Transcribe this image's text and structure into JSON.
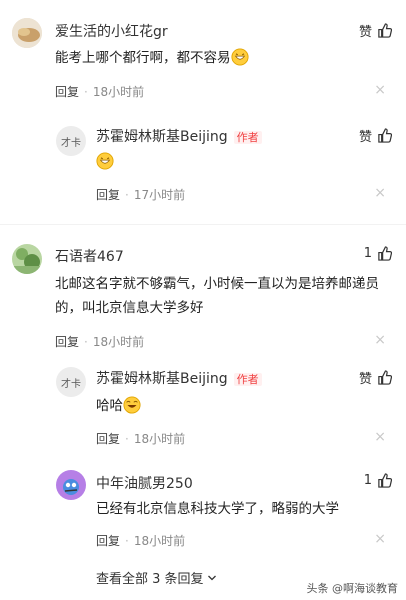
{
  "reply_label": "回复",
  "close_glyph": "×",
  "author_badge": "作者",
  "comments": [
    {
      "user": "爱生活的小红花gr",
      "text": "能考上哪个都行啊，都不容易",
      "emoji": "grin",
      "time": "18小时前",
      "like": "赞"
    },
    {
      "user": "苏霍姆林斯基Beijing",
      "text": "",
      "emoji": "grin",
      "time": "17小时前",
      "like": "赞",
      "avatar_text": "才卡"
    },
    {
      "user": "石语者467",
      "text": "北邮这名字就不够霸气，小时候一直以为是培养邮递员的，叫北京信息大学多好",
      "time": "18小时前",
      "like": "1"
    },
    {
      "user": "苏霍姆林斯基Beijing",
      "text": "哈哈",
      "emoji": "laugh",
      "time": "18小时前",
      "like": "赞",
      "avatar_text": "才卡"
    },
    {
      "user": "中年油腻男250",
      "text": "已经有北京信息科技大学了，略弱的大学",
      "time": "18小时前",
      "like": "1"
    }
  ],
  "view_all": "查看全部 3 条回复",
  "watermark": "头条 @啊海谈教育",
  "colors": {
    "author_tag": "#f04142",
    "meta": "#888888"
  }
}
